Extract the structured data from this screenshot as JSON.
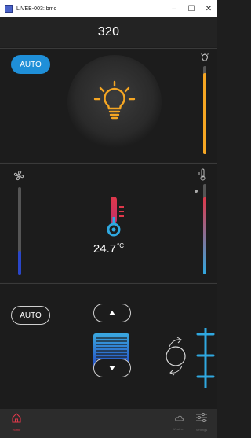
{
  "window": {
    "title": "LIVEB-003: bmc",
    "minimize": "–",
    "maximize": "☐",
    "close": "✕"
  },
  "header": {
    "value": "320"
  },
  "light_panel": {
    "auto_label": "AUTO",
    "level": 0.92,
    "accent": "#f5a623"
  },
  "climate_panel": {
    "temperature": "24.7",
    "unit": "°C",
    "fan_level": 0.28,
    "temp_level": 0.85,
    "fan_color": "#2a46c8",
    "temp_color_top": "#e0384a",
    "temp_color_bottom": "#2fa8e0"
  },
  "vent_panel": {
    "auto_label": "AUTO"
  },
  "tabs": [
    {
      "name": "Home",
      "icon": "home-icon",
      "active": true,
      "color": "#e0384a"
    },
    {
      "name": "Weather",
      "icon": "cloud-icon",
      "active": false
    },
    {
      "name": "Settings",
      "icon": "sliders-icon",
      "active": false
    }
  ]
}
